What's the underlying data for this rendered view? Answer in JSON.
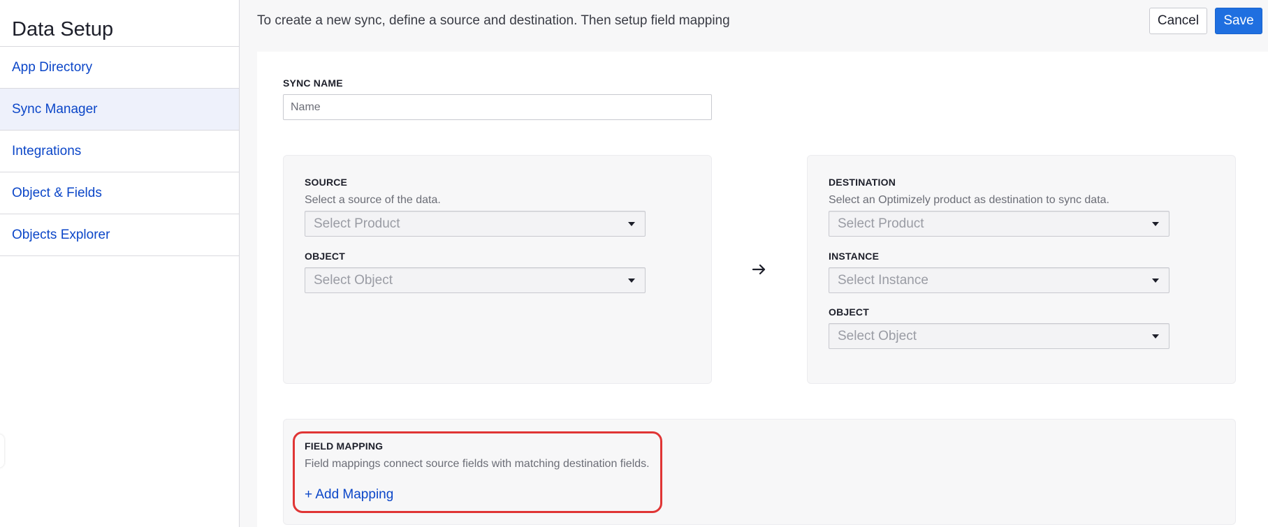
{
  "sidebar": {
    "title": "Data Setup",
    "items": [
      {
        "label": "App Directory",
        "active": false
      },
      {
        "label": "Sync Manager",
        "active": true
      },
      {
        "label": "Integrations",
        "active": false
      },
      {
        "label": "Object & Fields",
        "active": false
      },
      {
        "label": "Objects Explorer",
        "active": false
      }
    ]
  },
  "header": {
    "message": "To create a new sync, define a source and destination. Then setup field mapping",
    "cancel_label": "Cancel",
    "save_label": "Save"
  },
  "sync_name": {
    "label": "SYNC NAME",
    "placeholder": "Name",
    "value": ""
  },
  "source": {
    "label": "SOURCE",
    "description": "Select a source of the data.",
    "product_placeholder": "Select Product",
    "object_label": "OBJECT",
    "object_placeholder": "Select Object"
  },
  "destination": {
    "label": "DESTINATION",
    "description": "Select an Optimizely product as destination to sync data.",
    "product_placeholder": "Select Product",
    "instance_label": "INSTANCE",
    "instance_placeholder": "Select Instance",
    "object_label": "OBJECT",
    "object_placeholder": "Select Object"
  },
  "field_mapping": {
    "label": "FIELD MAPPING",
    "description": "Field mappings connect source fields with matching destination fields.",
    "add_label": "+ Add Mapping"
  },
  "icons": {
    "arrow": "arrow-right-icon",
    "caret": "chevron-down-icon"
  },
  "colors": {
    "link": "#0b46c8",
    "primary": "#1f6fe0",
    "highlight": "#e03535",
    "active_nav": "#eef1fb"
  }
}
